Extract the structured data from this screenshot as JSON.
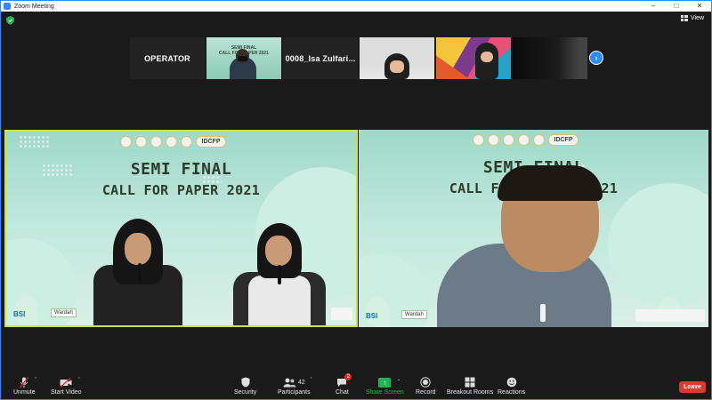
{
  "window": {
    "title": "Zoom Meeting"
  },
  "view_button": {
    "label": "View"
  },
  "thumbnails": [
    {
      "name": "OPERATOR",
      "type": "name"
    },
    {
      "name": "",
      "type": "video-poster",
      "poster_l1": "SEMI FINAL",
      "poster_l2": "CALL FOR PAPER 2021"
    },
    {
      "name": "0008_Isa  Zulfari...",
      "type": "name"
    },
    {
      "name": "",
      "type": "video-girl"
    },
    {
      "name": "",
      "type": "video-art"
    },
    {
      "name": "",
      "type": "video-dark"
    }
  ],
  "main_videos": {
    "left": {
      "headline1": "SEMI FINAL",
      "headline2": "CALL FOR PAPER 2021",
      "logo_text": "IDCFP",
      "bsi": "BSI",
      "wardah": "Wardah"
    },
    "right": {
      "headline1": "SEMI FINAL",
      "headline2": "CALL F",
      "headline2b": "2021",
      "logo_text": "IDCFP",
      "bsi": "BSI",
      "wardah": "Wardah"
    }
  },
  "toolbar": {
    "unmute": "Unmute",
    "start_video": "Start Video",
    "security": "Security",
    "participants": "Participants",
    "participants_count": "42",
    "chat": "Chat",
    "chat_badge": "2",
    "share_screen": "Share Screen",
    "record": "Record",
    "breakout_rooms": "Breakout Rooms",
    "reactions": "Reactions",
    "leave": "Leave"
  },
  "colors": {
    "accent": "#2d8cff",
    "active_speaker": "#c8e64a",
    "share_green": "#1fb550",
    "leave_red": "#d63c2f"
  }
}
